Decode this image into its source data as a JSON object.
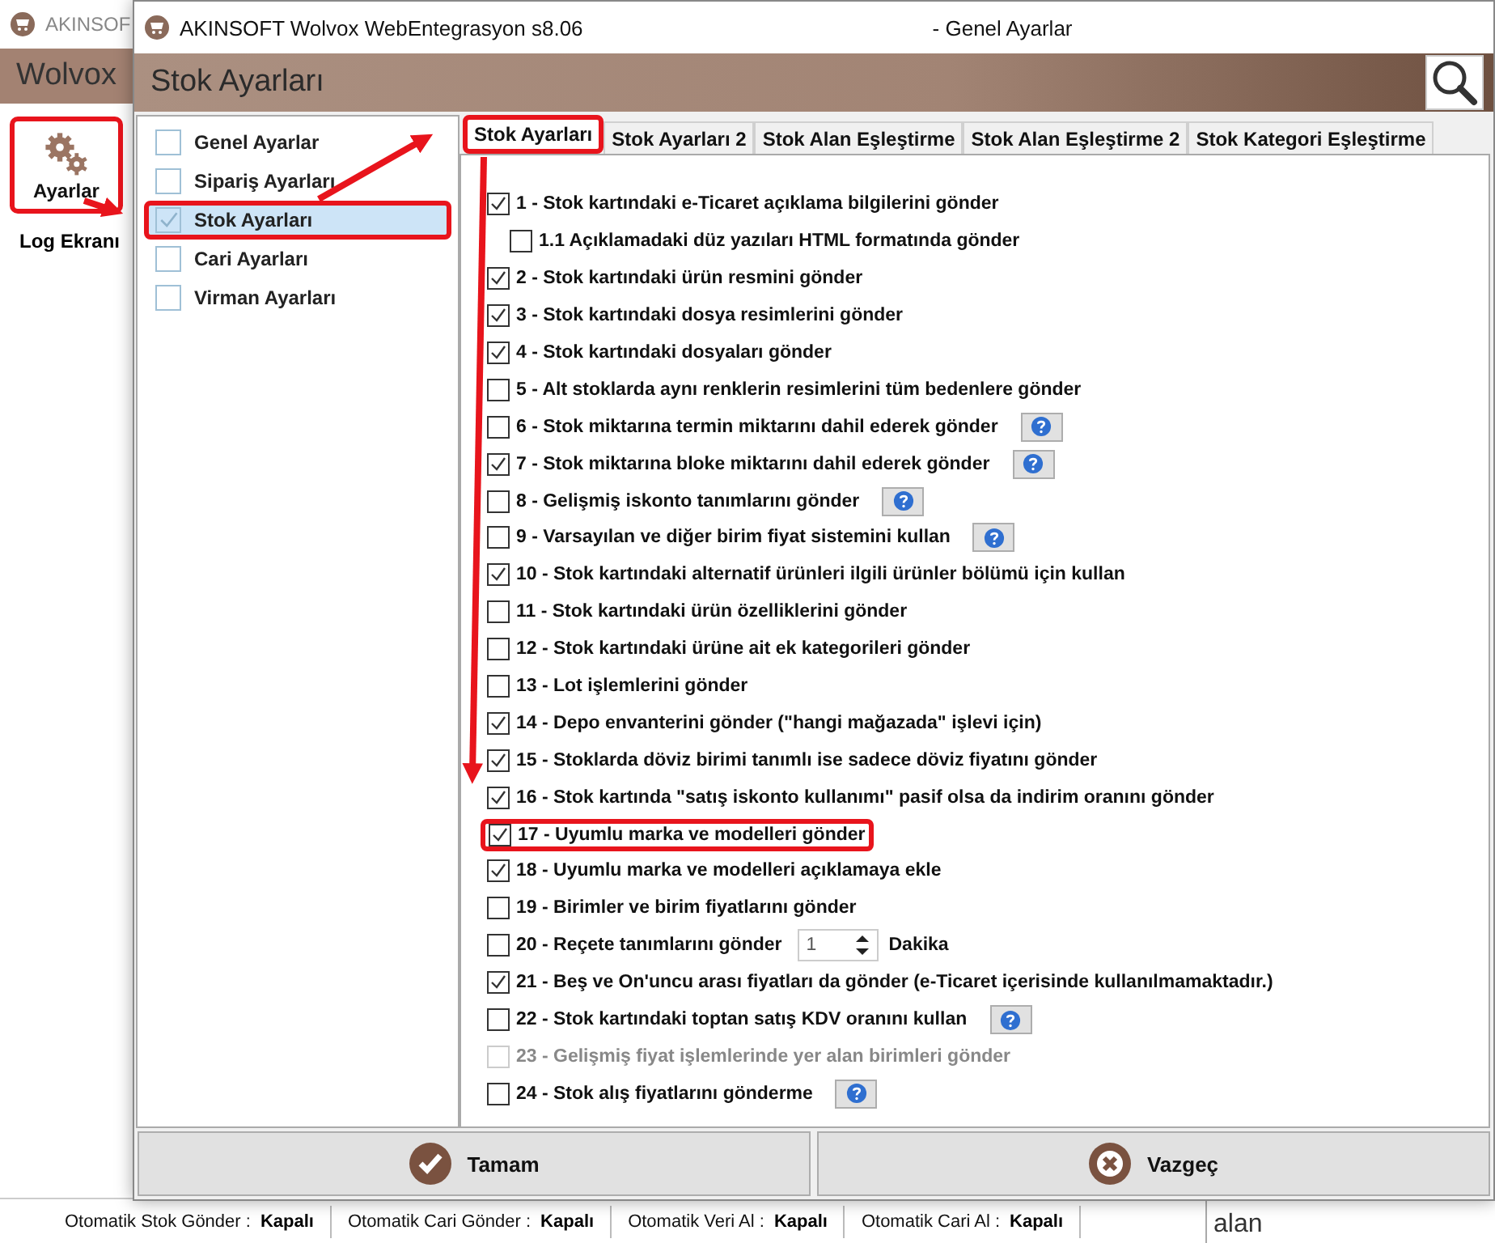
{
  "background_window": {
    "title": "AKINSOF",
    "header": "Wolvox",
    "sidebar_button": {
      "label": "Ayarlar",
      "highlighted": true
    },
    "sidebar_items": [
      "Log Ekranı"
    ],
    "status_bar": [
      {
        "label": "Otomatik Stok Gönder :",
        "value": "Kapalı"
      },
      {
        "label": "Otomatik Cari Gönder :",
        "value": "Kapalı"
      },
      {
        "label": "Otomatik Veri Al :",
        "value": "Kapalı"
      },
      {
        "label": "Otomatik Cari Al :",
        "value": "Kapalı"
      }
    ],
    "partial_text": "alan"
  },
  "dialog": {
    "title": "AKINSOFT Wolvox WebEntegrasyon s8.06",
    "subtitle": "- Genel Ayarlar",
    "header": "Stok Ayarları",
    "categories": [
      {
        "label": "Genel Ayarlar",
        "selected": false,
        "highlighted": false
      },
      {
        "label": "Sipariş Ayarları",
        "selected": false,
        "highlighted": false
      },
      {
        "label": "Stok Ayarları",
        "selected": true,
        "highlighted": true
      },
      {
        "label": "Cari Ayarları",
        "selected": false,
        "highlighted": false
      },
      {
        "label": "Virman Ayarları",
        "selected": false,
        "highlighted": false
      }
    ],
    "tabs": [
      {
        "label": "Stok Ayarları",
        "selected": true,
        "highlighted": true
      },
      {
        "label": "Stok Ayarları 2",
        "selected": false,
        "highlighted": false
      },
      {
        "label": "Stok Alan Eşleştirme",
        "selected": false,
        "highlighted": false
      },
      {
        "label": "Stok Alan Eşleştirme 2",
        "selected": false,
        "highlighted": false
      },
      {
        "label": "Stok Kategori Eşleştirme",
        "selected": false,
        "highlighted": false
      }
    ],
    "options": [
      {
        "kind": "checkbox",
        "label": "1 - Stok kartındaki e-Ticaret açıklama bilgilerini gönder",
        "checked": true,
        "disabled": false,
        "help": false,
        "highlighted": false,
        "children": [
          {
            "kind": "checkbox",
            "label": "1.1 Açıklamadaki düz yazıları HTML formatında gönder",
            "checked": false,
            "disabled": false,
            "help": false,
            "highlighted": false
          }
        ]
      },
      {
        "kind": "checkbox",
        "label": "2 - Stok kartındaki ürün resmini gönder",
        "checked": true,
        "disabled": false,
        "help": false,
        "highlighted": false
      },
      {
        "kind": "checkbox",
        "label": "3 - Stok kartındaki dosya resimlerini gönder",
        "checked": true,
        "disabled": false,
        "help": false,
        "highlighted": false
      },
      {
        "kind": "checkbox",
        "label": "4 - Stok kartındaki dosyaları gönder",
        "checked": true,
        "disabled": false,
        "help": false,
        "highlighted": false
      },
      {
        "kind": "checkbox",
        "label": "5 - Alt stoklarda aynı renklerin resimlerini tüm bedenlere gönder",
        "checked": false,
        "disabled": false,
        "help": false,
        "highlighted": false
      },
      {
        "kind": "checkbox",
        "label": "6 - Stok miktarına termin miktarını dahil ederek gönder",
        "checked": false,
        "disabled": false,
        "help": true,
        "highlighted": false
      },
      {
        "kind": "checkbox",
        "label": "7 - Stok miktarına bloke miktarını dahil ederek gönder",
        "checked": true,
        "disabled": false,
        "help": true,
        "highlighted": false
      },
      {
        "kind": "checkbox",
        "label": "8 - Gelişmiş iskonto tanımlarını gönder",
        "checked": false,
        "disabled": false,
        "help": true,
        "highlighted": false
      },
      {
        "kind": "checkbox",
        "label": "9 - Varsayılan ve diğer birim fiyat sistemini kullan",
        "checked": false,
        "disabled": false,
        "help": true,
        "highlighted": false
      },
      {
        "kind": "checkbox",
        "label": "10 - Stok kartındaki alternatif ürünleri ilgili ürünler bölümü için kullan",
        "checked": true,
        "disabled": false,
        "help": false,
        "highlighted": false
      },
      {
        "kind": "checkbox",
        "label": "11 - Stok kartındaki ürün özelliklerini gönder",
        "checked": false,
        "disabled": false,
        "help": false,
        "highlighted": false
      },
      {
        "kind": "checkbox",
        "label": "12 - Stok kartındaki ürüne ait ek kategorileri gönder",
        "checked": false,
        "disabled": false,
        "help": false,
        "highlighted": false
      },
      {
        "kind": "checkbox",
        "label": "13 - Lot işlemlerini gönder",
        "checked": false,
        "disabled": false,
        "help": false,
        "highlighted": false
      },
      {
        "kind": "checkbox",
        "label": "14 - Depo envanterini gönder (\"hangi mağazada\" işlevi için)",
        "checked": true,
        "disabled": false,
        "help": false,
        "highlighted": false
      },
      {
        "kind": "checkbox",
        "label": "15 - Stoklarda döviz birimi tanımlı ise sadece döviz fiyatını gönder",
        "checked": true,
        "disabled": false,
        "help": false,
        "highlighted": false
      },
      {
        "kind": "checkbox",
        "label": "16 - Stok kartında \"satış iskonto kullanımı\" pasif olsa da indirim oranını gönder",
        "checked": true,
        "disabled": false,
        "help": false,
        "highlighted": false
      },
      {
        "kind": "checkbox",
        "label": "17 - Uyumlu marka ve modelleri gönder",
        "checked": true,
        "disabled": false,
        "help": false,
        "highlighted": true
      },
      {
        "kind": "checkbox",
        "label": "18 - Uyumlu marka ve modelleri açıklamaya ekle",
        "checked": true,
        "disabled": false,
        "help": false,
        "highlighted": false
      },
      {
        "kind": "checkbox",
        "label": "19 - Birimler ve birim fiyatlarını gönder",
        "checked": false,
        "disabled": false,
        "help": false,
        "highlighted": false
      },
      {
        "kind": "spinner",
        "label": "20 - Reçete tanımlarını gönder",
        "checked": false,
        "disabled": false,
        "help": false,
        "highlighted": false,
        "value": "1",
        "unit": "Dakika"
      },
      {
        "kind": "checkbox",
        "label": "21 - Beş ve On'uncu arası fiyatları da gönder (e-Ticaret içerisinde kullanılmamaktadır.)",
        "checked": true,
        "disabled": false,
        "help": false,
        "highlighted": false
      },
      {
        "kind": "checkbox",
        "label": "22 - Stok kartındaki toptan satış KDV oranını kullan",
        "checked": false,
        "disabled": false,
        "help": true,
        "highlighted": false
      },
      {
        "kind": "checkbox",
        "label": "23 - Gelişmiş fiyat işlemlerinde yer alan birimleri gönder",
        "checked": false,
        "disabled": true,
        "help": false,
        "highlighted": false
      },
      {
        "kind": "checkbox",
        "label": "24 - Stok alış fiyatlarını gönderme",
        "checked": false,
        "disabled": false,
        "help": true,
        "highlighted": false
      }
    ],
    "buttons": [
      {
        "kind": "ok",
        "label": "Tamam"
      },
      {
        "kind": "cancel",
        "label": "Vazgeç"
      }
    ]
  }
}
